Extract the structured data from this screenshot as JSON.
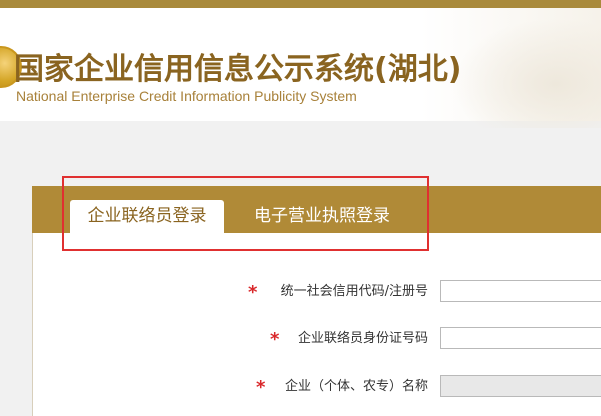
{
  "header": {
    "title_cn": "国家企业信用信息公示系统(湖北)",
    "title_en": "National Enterprise Credit Information Publicity System"
  },
  "tabs": [
    {
      "label": "企业联络员登录",
      "active": true
    },
    {
      "label": "电子营业执照登录",
      "active": false
    }
  ],
  "form": {
    "fields": [
      {
        "label": "统一社会信用代码/注册号",
        "required": true,
        "value": "",
        "disabled": false
      },
      {
        "label": "企业联络员身份证号码",
        "required": true,
        "value": "",
        "disabled": false
      },
      {
        "label": "企业（个体、农专）名称",
        "required": true,
        "value": "",
        "disabled": true
      }
    ],
    "required_mark": "*"
  },
  "colors": {
    "brand_gold": "#b08a37",
    "title_brown": "#8a6420",
    "required_red": "#d9282b",
    "annotation_red": "#e03030"
  }
}
